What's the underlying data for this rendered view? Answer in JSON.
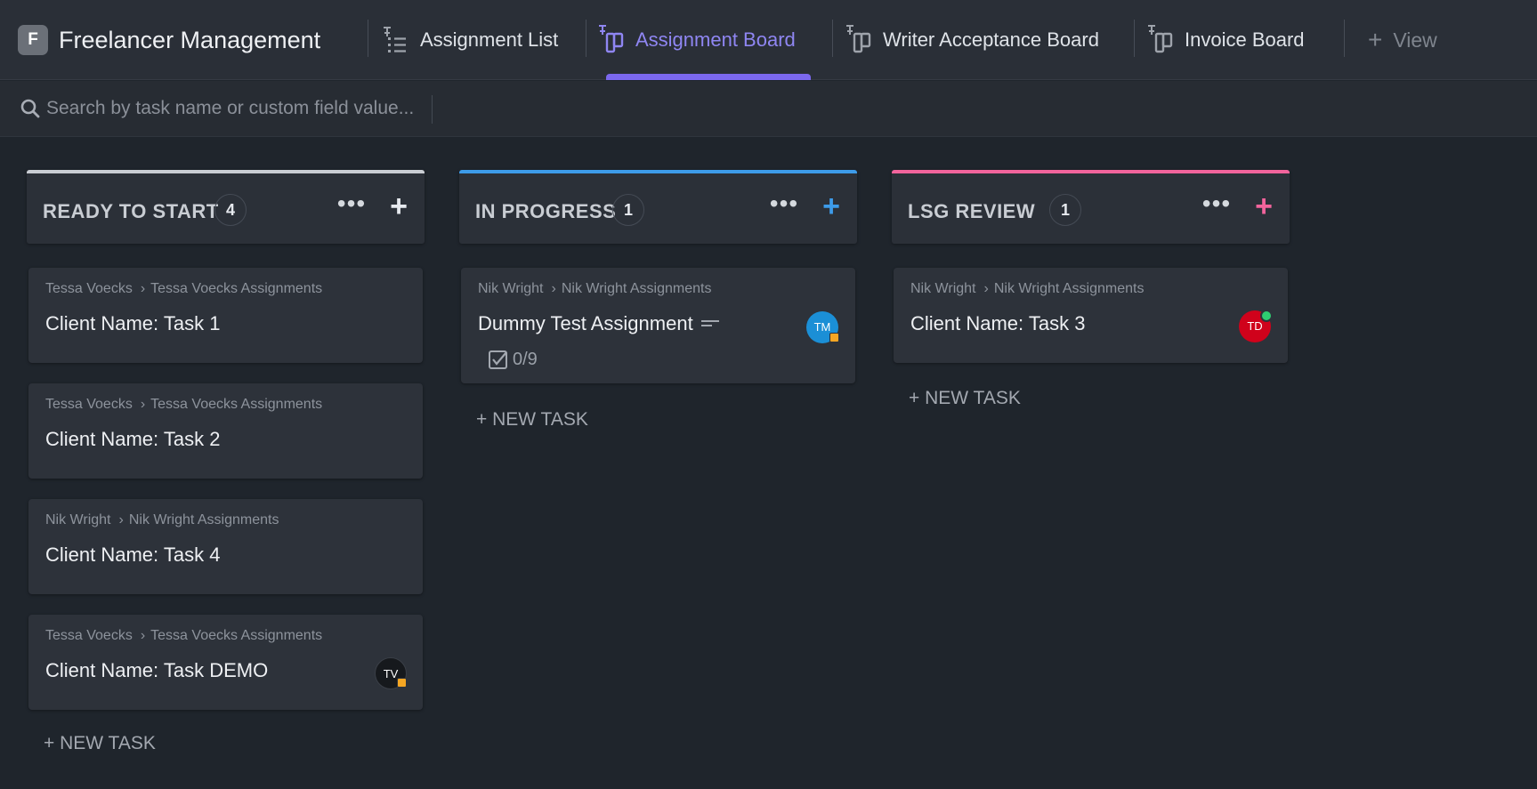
{
  "header": {
    "space_initial": "F",
    "space_name": "Freelancer Management",
    "tabs": [
      {
        "label": "Assignment List",
        "icon": "list-icon",
        "active": false
      },
      {
        "label": "Assignment Board",
        "icon": "board-icon",
        "active": true
      },
      {
        "label": "Writer Acceptance Board",
        "icon": "board-icon",
        "active": false
      },
      {
        "label": "Invoice Board",
        "icon": "board-icon",
        "active": false
      }
    ],
    "add_view_label": "View"
  },
  "search": {
    "placeholder": "Search by task name or custom field value..."
  },
  "colors": {
    "ready": "#c9cdd3",
    "in_progress": "#3d9be9",
    "review": "#f2649c",
    "accent": "#7b68ee"
  },
  "columns": [
    {
      "title": "READY TO START",
      "count": "4",
      "cards": [
        {
          "crumb_parent": "Tessa Voecks",
          "crumb_list": "Tessa Voecks Assignments",
          "title": "Client Name: Task 1"
        },
        {
          "crumb_parent": "Tessa Voecks",
          "crumb_list": "Tessa Voecks Assignments",
          "title": "Client Name: Task 2"
        },
        {
          "crumb_parent": "Nik Wright",
          "crumb_list": "Nik Wright Assignments",
          "title": "Client Name: Task 4"
        },
        {
          "crumb_parent": "Tessa Voecks",
          "crumb_list": "Tessa Voecks Assignments",
          "title": "Client Name: Task DEMO",
          "assignee": "TV"
        }
      ],
      "new_task_label": "+ NEW TASK"
    },
    {
      "title": "IN PROGRESS",
      "count": "1",
      "cards": [
        {
          "crumb_parent": "Nik Wright",
          "crumb_list": "Nik Wright Assignments",
          "title": "Dummy Test Assignment",
          "checklist": "0/9",
          "assignee": "TM"
        }
      ],
      "new_task_label": "+ NEW TASK"
    },
    {
      "title": "LSG REVIEW",
      "count": "1",
      "cards": [
        {
          "crumb_parent": "Nik Wright",
          "crumb_list": "Nik Wright Assignments",
          "title": "Client Name: Task 3",
          "assignee": "TD"
        }
      ],
      "new_task_label": "+ NEW TASK"
    }
  ]
}
